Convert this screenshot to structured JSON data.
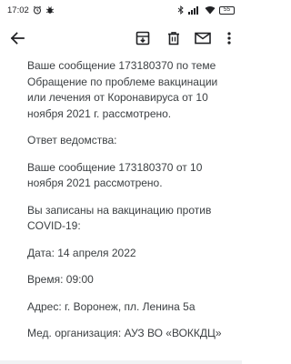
{
  "status_bar": {
    "time": "17:02",
    "battery": "55"
  },
  "toolbar": {
    "back_icon": "arrow-back-icon",
    "archive_icon": "archive-icon",
    "delete_icon": "trash-icon",
    "mark_unread_icon": "mail-icon",
    "more_icon": "more-vert-icon"
  },
  "message": {
    "paragraphs": [
      "Ваше сообщение 173180370 по теме Обращение по проблеме вакцинации или лечения от Коронавируса от 10 ноября 2021 г. рассмотрено.",
      "Ответ ведомства:",
      "Ваше сообщение 173180370 от 10 ноября 2021 рассмотрено.",
      "Вы записаны на вакцинацию против COVID-19:",
      "Дата: 14 апреля 2022",
      "Время: 09:00",
      "Адрес: г. Воронеж, пл. Ленина 5а",
      "Мед. организация: АУЗ ВО «ВОККДЦ»"
    ]
  },
  "colors": {
    "text": "#3c4043",
    "icon": "#202124",
    "background": "#ffffff"
  }
}
